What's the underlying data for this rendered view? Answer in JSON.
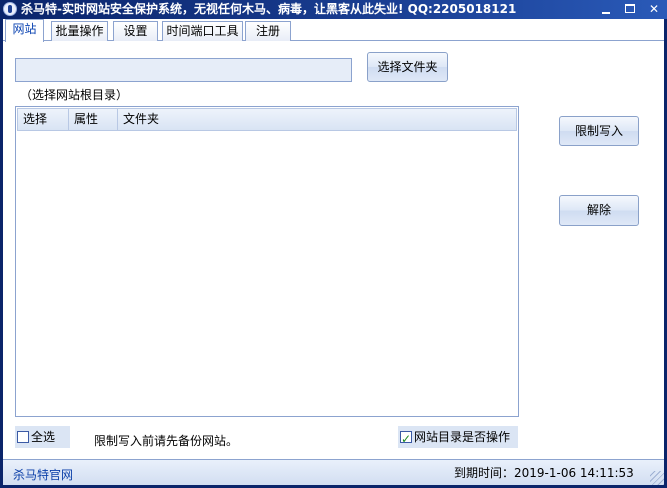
{
  "window": {
    "title": "杀马特-实时网站安全保护系统，无视任何木马、病毒，让黑客从此失业! QQ:2205018121"
  },
  "tabs": [
    {
      "label": "网站",
      "active": true
    },
    {
      "label": "批量操作",
      "active": false
    },
    {
      "label": "设置",
      "active": false
    },
    {
      "label": "时间端口工具",
      "active": false
    },
    {
      "label": "注册",
      "active": false
    }
  ],
  "site_tab": {
    "path_value": "",
    "select_folder_label": "选择文件夹",
    "hint": "（选择网站根目录）",
    "columns": [
      "选择",
      "属性",
      "文件夹"
    ],
    "rows": [],
    "limit_write_label": "限制写入",
    "unlock_label": "解除",
    "select_all_label": "全选",
    "select_all_checked": false,
    "backup_warning": "限制写入前请先备份网站。",
    "dir_operate_label": "网站目录是否操作",
    "dir_operate_checked": true
  },
  "status": {
    "site_link": "杀马特官网",
    "expire": "到期时间：2019-1-06 14:11:53"
  },
  "colors": {
    "title_bar": "#0a246a",
    "accent": "#0b43b2",
    "panel": "#dbe5f4"
  }
}
